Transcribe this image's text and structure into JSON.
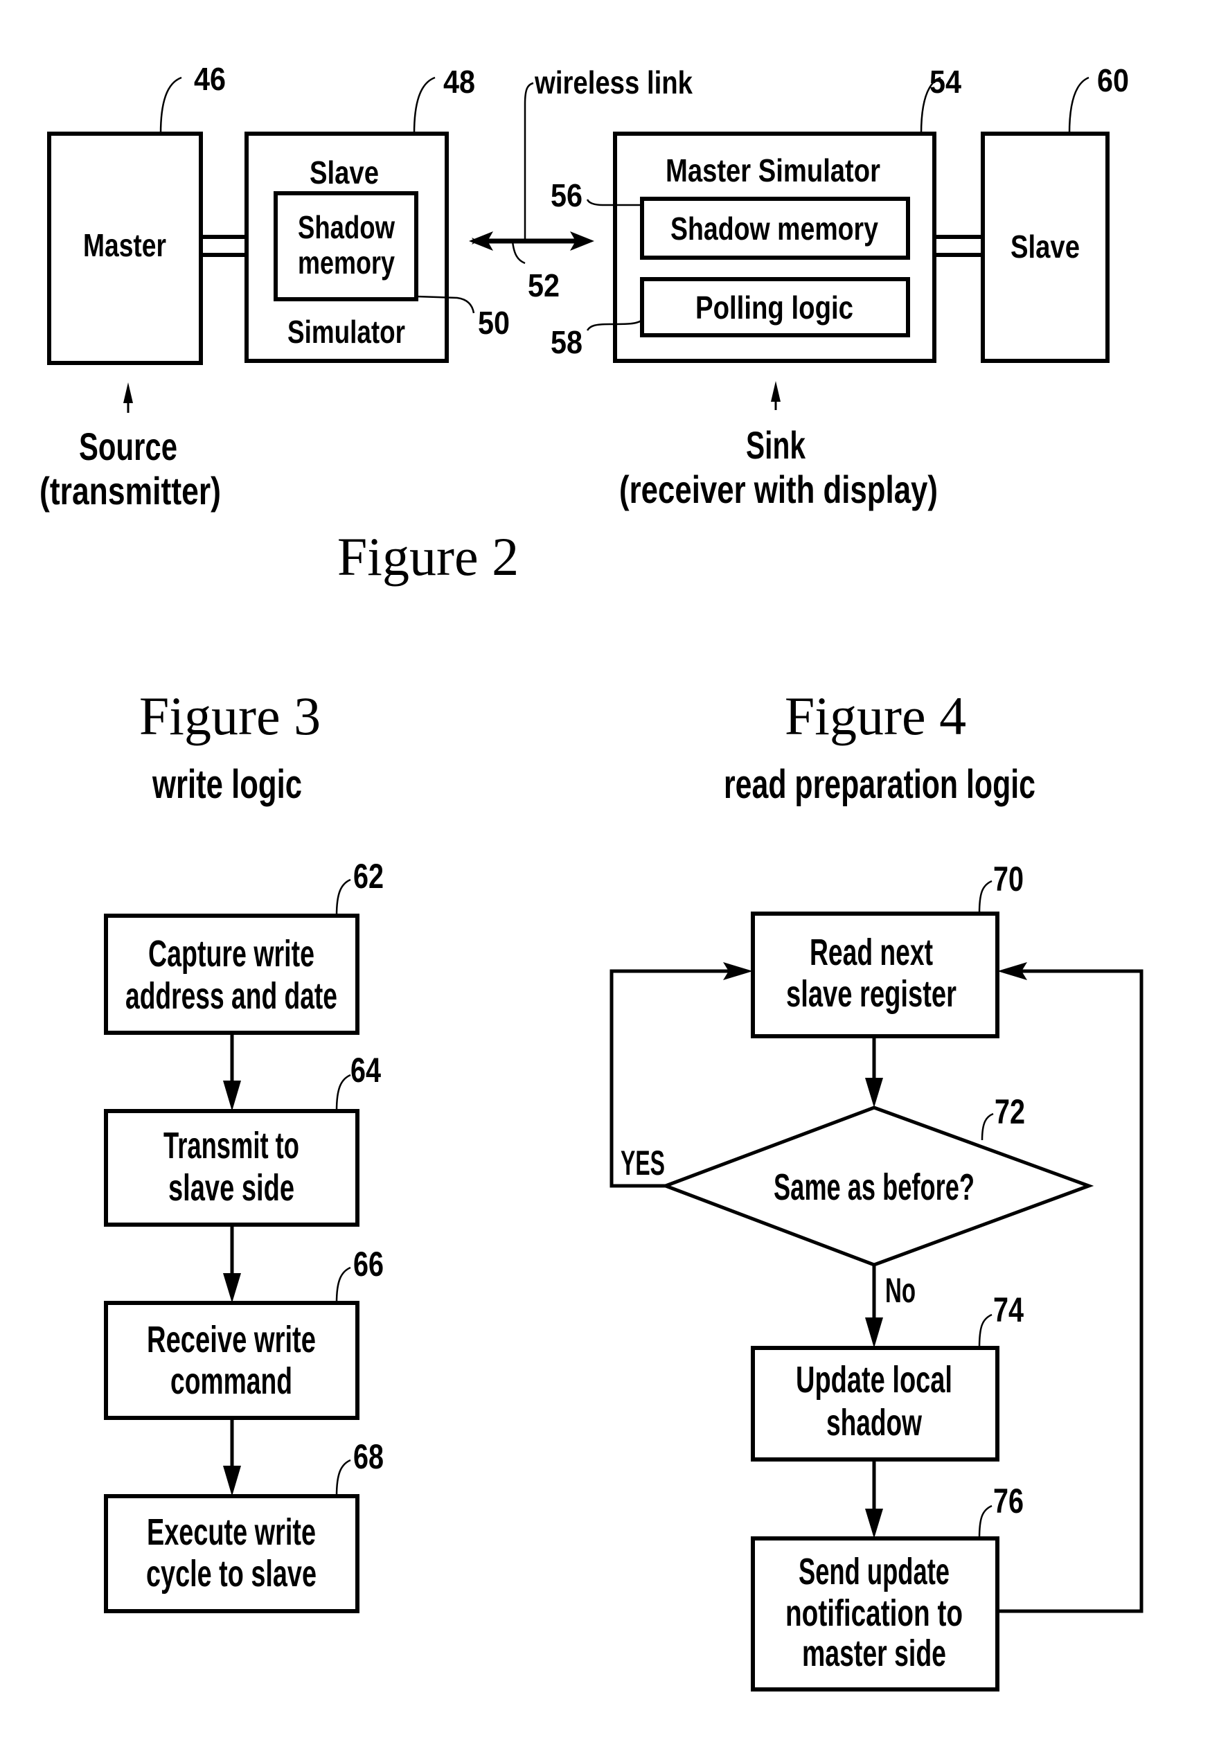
{
  "figure2": {
    "caption": "Figure 2",
    "master": {
      "label": "Master",
      "ref": "46"
    },
    "slave_simulator": {
      "top_label": "Slave",
      "bottom_label": "Simulator",
      "ref": "48",
      "shadow": {
        "line1": "Shadow",
        "line2": "memory",
        "ref": "50"
      }
    },
    "wireless": {
      "label": "wireless link",
      "ref": "52"
    },
    "master_simulator": {
      "label": "Master Simulator",
      "ref": "54",
      "shadow": {
        "label": "Shadow memory",
        "ref": "56"
      },
      "polling": {
        "label": "Polling logic",
        "ref": "58"
      }
    },
    "slave": {
      "label": "Slave",
      "ref": "60"
    },
    "source": {
      "line1": "Source",
      "line2": "(transmitter)"
    },
    "sink": {
      "line1": "Sink",
      "line2": "(receiver with display)"
    }
  },
  "figure3": {
    "caption": "Figure 3",
    "subtitle": "write logic",
    "steps": [
      {
        "ref": "62",
        "lines": [
          "Capture write",
          "address and date"
        ]
      },
      {
        "ref": "64",
        "lines": [
          "Transmit to",
          "slave side"
        ]
      },
      {
        "ref": "66",
        "lines": [
          "Receive write",
          "command"
        ]
      },
      {
        "ref": "68",
        "lines": [
          "Execute write",
          "cycle to slave"
        ]
      }
    ]
  },
  "figure4": {
    "caption": "Figure 4",
    "subtitle": "read preparation logic",
    "read": {
      "ref": "70",
      "lines": [
        "Read next",
        "slave register"
      ]
    },
    "decision": {
      "ref": "72",
      "label": "Same as before?",
      "yes": "YES",
      "no": "No"
    },
    "update": {
      "ref": "74",
      "lines": [
        "Update local",
        "shadow"
      ]
    },
    "notify": {
      "ref": "76",
      "lines": [
        "Send update",
        "notification to",
        "master side"
      ]
    }
  }
}
